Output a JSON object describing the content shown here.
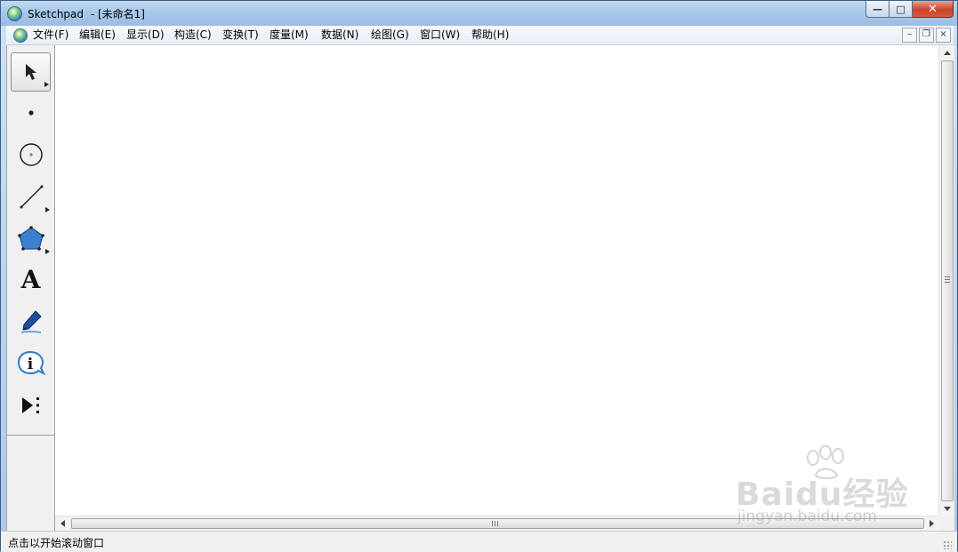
{
  "window": {
    "app_name": "Sketchpad",
    "document_title": " - [未命名1]",
    "controls": {
      "minimize": "—",
      "maximize": "□",
      "close": "✕"
    }
  },
  "menu": {
    "items": [
      {
        "label": "文件(F)"
      },
      {
        "label": "编辑(E)"
      },
      {
        "label": "显示(D)"
      },
      {
        "label": "构造(C)"
      },
      {
        "label": "变换(T)"
      },
      {
        "label": "度量(M)"
      },
      {
        "label": "数据(N)"
      },
      {
        "label": "绘图(G)"
      },
      {
        "label": "窗口(W)"
      },
      {
        "label": "帮助(H)"
      }
    ],
    "doc_controls": {
      "minimize": "–",
      "restore": "❐",
      "close": "×"
    }
  },
  "toolbox": {
    "tools": [
      {
        "name": "arrow-select-tool",
        "icon": "arrow-cursor-icon",
        "selected": true
      },
      {
        "name": "point-tool",
        "icon": "point-icon"
      },
      {
        "name": "compass-tool",
        "icon": "circle-icon"
      },
      {
        "name": "straightedge-tool",
        "icon": "line-segment-icon"
      },
      {
        "name": "polygon-tool",
        "icon": "pentagon-icon"
      },
      {
        "name": "text-tool",
        "icon": "text-a-icon",
        "glyph": "A"
      },
      {
        "name": "marker-tool",
        "icon": "marker-pen-icon"
      },
      {
        "name": "information-tool",
        "icon": "info-icon"
      },
      {
        "name": "custom-tool",
        "icon": "custom-tools-icon"
      }
    ]
  },
  "status": {
    "text": "点击以开始滚动窗口"
  },
  "watermark": {
    "line1": "Baidu经验",
    "line2": "jingyan.baidu.com"
  }
}
